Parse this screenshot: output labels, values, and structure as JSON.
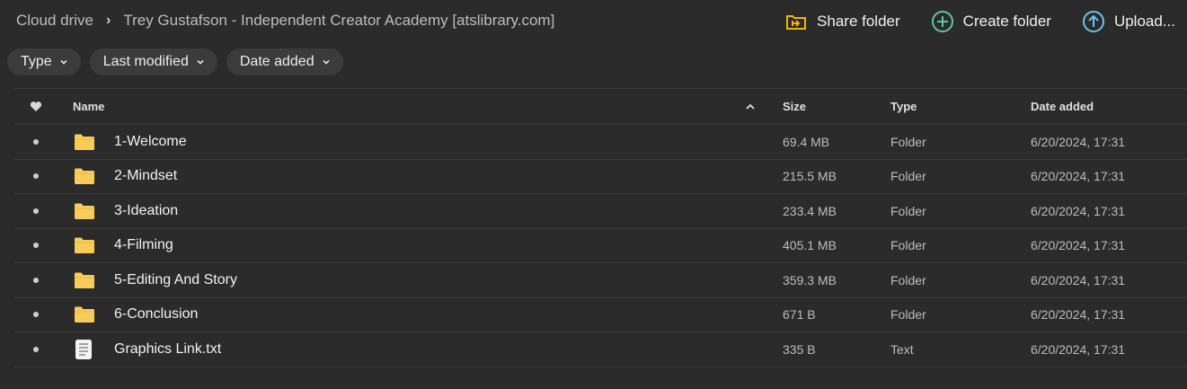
{
  "breadcrumb": {
    "root": "Cloud drive",
    "separator": "›",
    "current": "Trey Gustafson - Independent Creator Academy [atslibrary.com]"
  },
  "actions": {
    "share": "Share folder",
    "create": "Create folder",
    "upload": "Upload..."
  },
  "filters": [
    "Type",
    "Last modified",
    "Date added"
  ],
  "columns": {
    "name": "Name",
    "size": "Size",
    "type": "Type",
    "date": "Date added"
  },
  "colors": {
    "background": "#2b2b2b",
    "folder": "#f7cc5b",
    "share_icon": "#f4b400",
    "create_icon": "#5fc7a1",
    "upload_icon": "#6cc3f2"
  },
  "files": [
    {
      "name": "1-Welcome",
      "size": "69.4 MB",
      "type": "Folder",
      "date": "6/20/2024, 17:31",
      "icon": "folder-icon"
    },
    {
      "name": "2-Mindset",
      "size": "215.5 MB",
      "type": "Folder",
      "date": "6/20/2024, 17:31",
      "icon": "folder-icon"
    },
    {
      "name": "3-Ideation",
      "size": "233.4 MB",
      "type": "Folder",
      "date": "6/20/2024, 17:31",
      "icon": "folder-icon"
    },
    {
      "name": "4-Filming",
      "size": "405.1 MB",
      "type": "Folder",
      "date": "6/20/2024, 17:31",
      "icon": "folder-icon"
    },
    {
      "name": "5-Editing And Story",
      "size": "359.3 MB",
      "type": "Folder",
      "date": "6/20/2024, 17:31",
      "icon": "folder-icon"
    },
    {
      "name": "6-Conclusion",
      "size": "671 B",
      "type": "Folder",
      "date": "6/20/2024, 17:31",
      "icon": "folder-icon"
    },
    {
      "name": "Graphics Link.txt",
      "size": "335 B",
      "type": "Text",
      "date": "6/20/2024, 17:31",
      "icon": "text-file-icon"
    }
  ]
}
